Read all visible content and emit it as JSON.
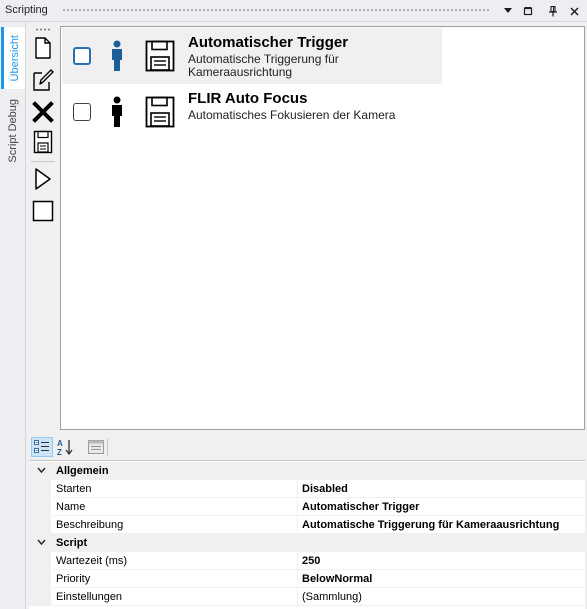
{
  "window": {
    "title": "Scripting",
    "buttons": [
      "dropdown-icon",
      "restore-icon",
      "pin-icon",
      "close-icon"
    ]
  },
  "vertical_tabs": [
    {
      "label": "Übersicht",
      "active": true
    },
    {
      "label": "Script Debug",
      "active": false
    }
  ],
  "toolbar": [
    "new-icon",
    "edit-icon",
    "delete-icon",
    "save-icon",
    "play-icon",
    "stop-icon"
  ],
  "scripts": [
    {
      "title": "Automatischer Trigger",
      "description": "Automatische Triggerung für Kameraausrichtung",
      "selected": true,
      "checked": false,
      "person_color": "#1b5e9a"
    },
    {
      "title": "FLIR Auto Focus",
      "description": "Automatisches Fokusieren der Kamera",
      "selected": false,
      "checked": false,
      "person_color": "#000000"
    }
  ],
  "property_grid": {
    "toolbar": [
      "categorized-icon",
      "alphabetical-icon",
      "property-pages-icon"
    ],
    "categories": [
      {
        "name": "Allgemein",
        "properties": [
          {
            "name": "Starten",
            "value": "Disabled"
          },
          {
            "name": "Name",
            "value": "Automatischer Trigger"
          },
          {
            "name": "Beschreibung",
            "value": "Automatische Triggerung für Kameraausrichtung"
          }
        ]
      },
      {
        "name": "Script",
        "properties": [
          {
            "name": "Wartezeit (ms)",
            "value": "250"
          },
          {
            "name": "Priority",
            "value": "BelowNormal"
          },
          {
            "name": "Einstellungen",
            "value": "(Sammlung)"
          }
        ]
      }
    ]
  },
  "colors": {
    "accent": "#1c97ea",
    "selected_row": "#f0f0f0"
  }
}
